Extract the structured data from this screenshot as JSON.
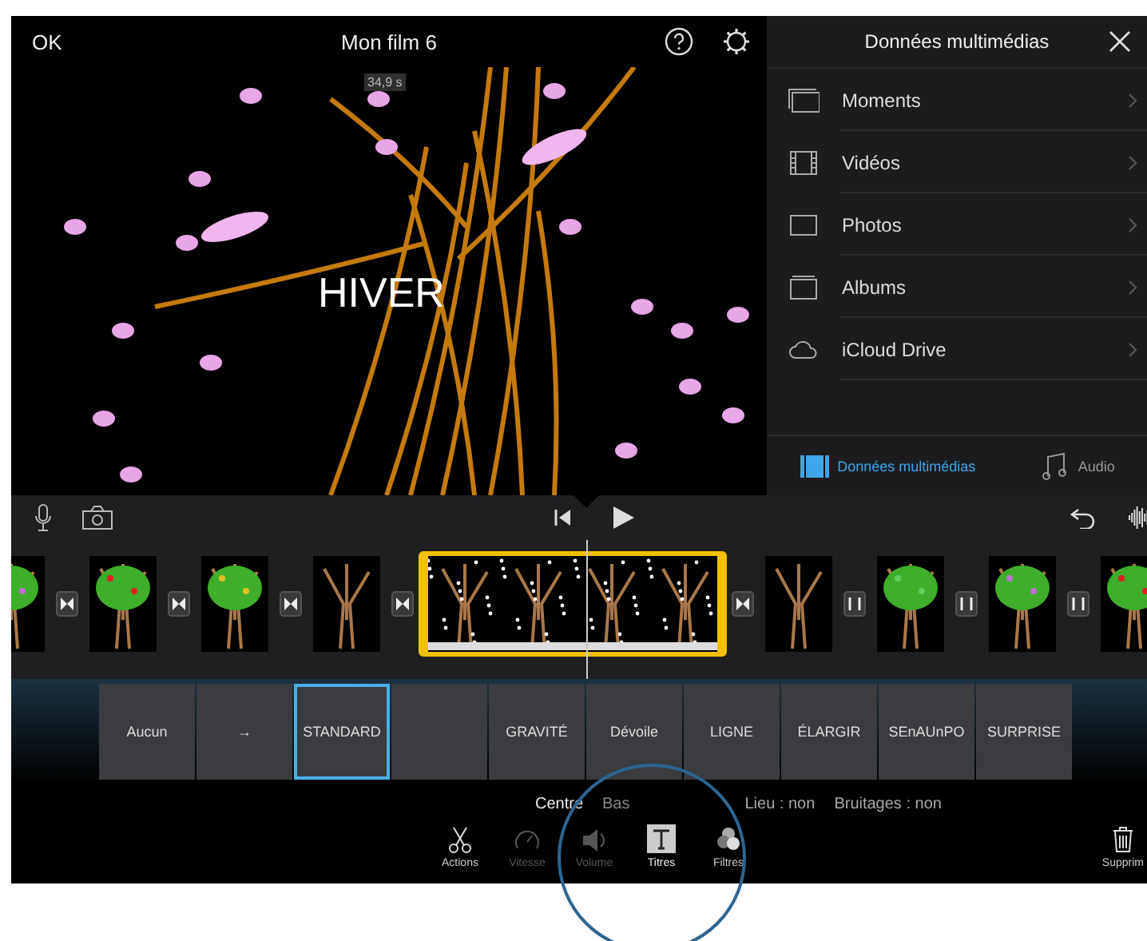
{
  "top_bar": {
    "left_button": "OK",
    "title": "Mon film 6"
  },
  "viewer": {
    "duration": "34,9 s",
    "title_text": "HIVER"
  },
  "media_panel": {
    "title": "Données multimédias",
    "items": [
      {
        "label": "Moments",
        "kind": "moments"
      },
      {
        "label": "Vidéos",
        "kind": "videos"
      },
      {
        "label": "Photos",
        "kind": "photos"
      },
      {
        "label": "Albums",
        "kind": "albums"
      },
      {
        "label": "iCloud Drive",
        "kind": "cloud"
      }
    ],
    "tabs": [
      {
        "label": "Données multimédias",
        "kind": "media",
        "selected": true
      },
      {
        "label": "Audio",
        "kind": "audio",
        "selected": false
      }
    ]
  },
  "timeline": {
    "items": [
      {
        "kind": "clip",
        "selected": false
      },
      {
        "kind": "transition"
      },
      {
        "kind": "clip",
        "selected": false
      },
      {
        "kind": "transition"
      },
      {
        "kind": "clip",
        "selected": false
      },
      {
        "kind": "transition"
      },
      {
        "kind": "clip",
        "selected": false
      },
      {
        "kind": "transition"
      },
      {
        "kind": "clip",
        "selected": true
      },
      {
        "kind": "transition"
      },
      {
        "kind": "clip",
        "selected": false
      },
      {
        "kind": "cut"
      },
      {
        "kind": "clip",
        "selected": false
      },
      {
        "kind": "cut"
      },
      {
        "kind": "clip",
        "selected": false
      },
      {
        "kind": "cut"
      },
      {
        "kind": "clip",
        "selected": false
      }
    ]
  },
  "title_styles": [
    {
      "label": "Aucun",
      "selected": false
    },
    {
      "label": "→",
      "selected": false
    },
    {
      "label": "STANDARD",
      "selected": true
    },
    {
      "selected": false
    },
    {
      "label": "GRAVITÉ",
      "selected": false
    },
    {
      "label": "Dévoile",
      "selected": false
    },
    {
      "label": "LIGNE",
      "selected": false
    },
    {
      "label": "ÉLARGIR",
      "selected": false
    },
    {
      "label": "SEnAUnPO",
      "selected": false
    },
    {
      "label": "SURPRISE",
      "selected": false
    }
  ],
  "title_options": {
    "positions": [
      {
        "label": "Centre",
        "selected": true
      },
      {
        "label": "Bas",
        "selected": false
      }
    ],
    "settings": [
      "Lieu : non",
      "Bruitages : non"
    ]
  },
  "tools": [
    {
      "label": "Actions",
      "kind": "scissors",
      "selected": false,
      "disabled": false
    },
    {
      "label": "Vitesse",
      "kind": "speed",
      "selected": false,
      "disabled": true
    },
    {
      "label": "Volume",
      "kind": "volume",
      "selected": false,
      "disabled": true
    },
    {
      "label": "Titres",
      "kind": "titles",
      "selected": true,
      "disabled": false
    },
    {
      "label": "Filtres",
      "kind": "filters",
      "selected": false,
      "disabled": false
    },
    {
      "label": "Supprim",
      "kind": "trash",
      "selected": false,
      "disabled": false
    }
  ]
}
